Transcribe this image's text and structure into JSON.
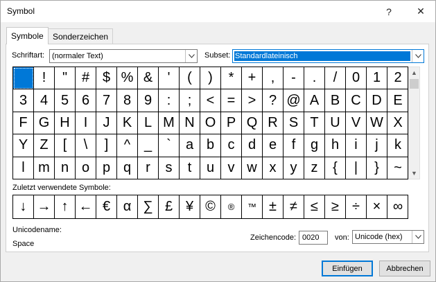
{
  "window": {
    "title": "Symbol",
    "help_glyph": "?",
    "close_glyph": "✕"
  },
  "tabs": [
    {
      "label": "Symbole",
      "active": true
    },
    {
      "label": "Sonderzeichen",
      "active": false
    }
  ],
  "font": {
    "label": "Schriftart:",
    "value": "(normaler Text)"
  },
  "subset": {
    "label": "Subset:",
    "value": "Standardlateinisch"
  },
  "symbols": [
    " ",
    "!",
    "\"",
    "#",
    "$",
    "%",
    "&",
    "'",
    "(",
    ")",
    "*",
    "+",
    ",",
    "-",
    ".",
    "/",
    "0",
    "1",
    "2",
    "3",
    "4",
    "5",
    "6",
    "7",
    "8",
    "9",
    ":",
    ";",
    "<",
    "=",
    ">",
    "?",
    "@",
    "A",
    "B",
    "C",
    "D",
    "E",
    "F",
    "G",
    "H",
    "I",
    "J",
    "K",
    "L",
    "M",
    "N",
    "O",
    "P",
    "Q",
    "R",
    "S",
    "T",
    "U",
    "V",
    "W",
    "X",
    "Y",
    "Z",
    "[",
    "\\",
    "]",
    "^",
    "_",
    "`",
    "a",
    "b",
    "c",
    "d",
    "e",
    "f",
    "g",
    "h",
    "i",
    "j",
    "k",
    "l",
    "m",
    "n",
    "o",
    "p",
    "q",
    "r",
    "s",
    "t",
    "u",
    "v",
    "w",
    "x",
    "y",
    "z",
    "{",
    "|",
    "}",
    "~"
  ],
  "recent": {
    "label": "Zuletzt verwendete Symbole:",
    "items": [
      "↓",
      "→",
      "↑",
      "←",
      "€",
      "α",
      "∑",
      "£",
      "¥",
      "©",
      "®",
      "™",
      "±",
      "≠",
      "≤",
      "≥",
      "÷",
      "×",
      "∞"
    ]
  },
  "unicode": {
    "name_label": "Unicodename:",
    "name_value": "Space",
    "code_label": "Zeichencode:",
    "code_value": "0020",
    "from_label": "von:",
    "from_value": "Unicode (hex)"
  },
  "buttons": {
    "insert": "Einfügen",
    "cancel": "Abbrechen"
  },
  "colors": {
    "accent": "#0078d7"
  }
}
